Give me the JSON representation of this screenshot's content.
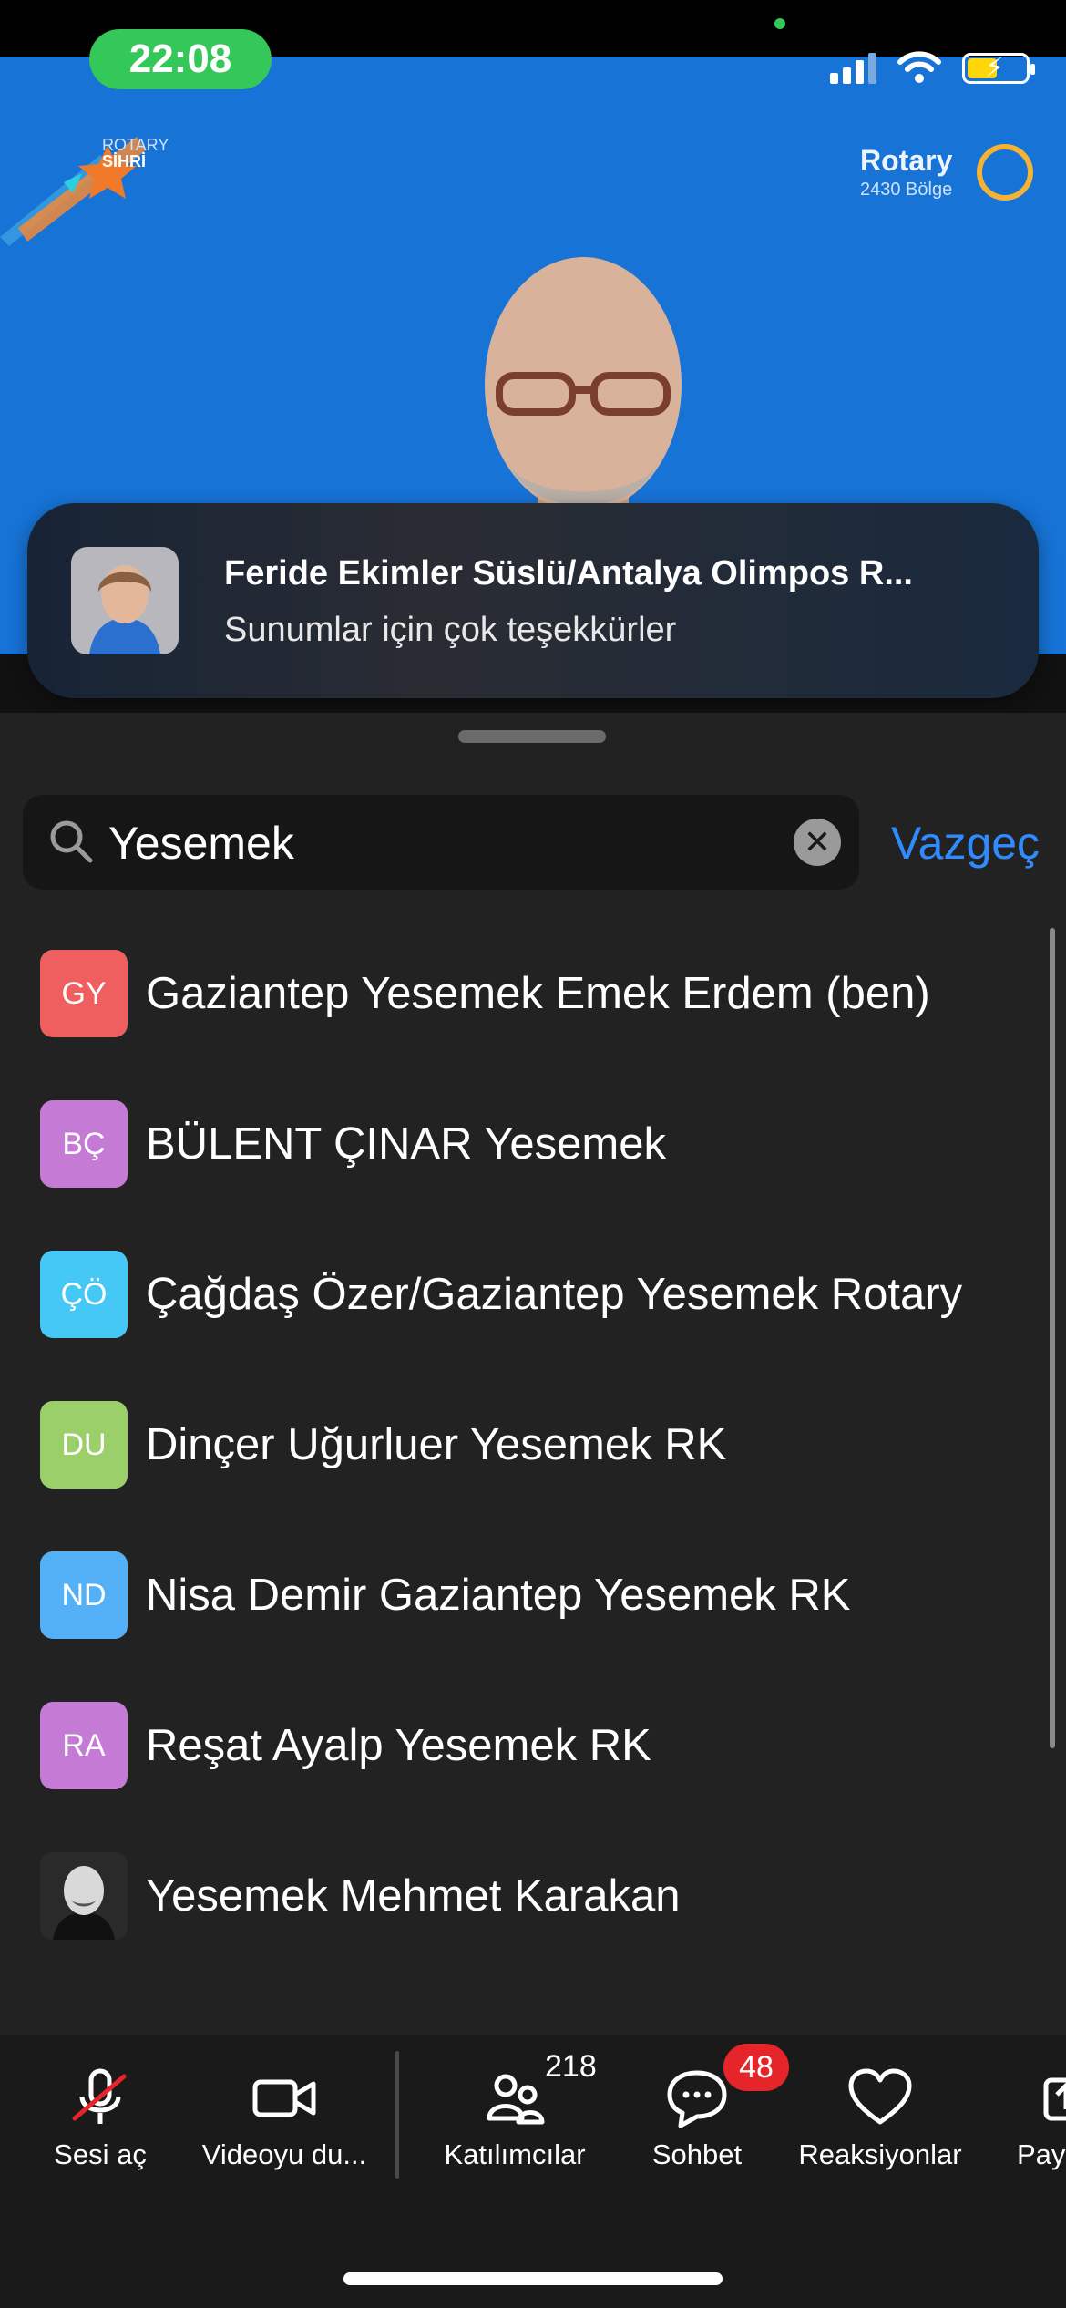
{
  "status_bar": {
    "time": "22:08"
  },
  "video": {
    "logo_left_text": [
      "ROTARY",
      "SİHRİ"
    ],
    "logo_right_word": "Rotary",
    "logo_right_sub": "2430 Bölge"
  },
  "toast": {
    "sender": "Feride Ekimler Süslü/Antalya Olimpos R...",
    "message": "Sunumlar için çok teşekkürler"
  },
  "search": {
    "query": "Yesemek",
    "cancel_label": "Vazgeç"
  },
  "participants": [
    {
      "initials": "GY",
      "name": "Gaziantep Yesemek Emek Erdem (ben)",
      "color": "#f05f5f"
    },
    {
      "initials": "BÇ",
      "name": "BÜLENT ÇINAR Yesemek",
      "color": "#c57ad6"
    },
    {
      "initials": "ÇÖ",
      "name": "Çağdaş Özer/Gaziantep Yesemek Rotary",
      "color": "#45c8f5"
    },
    {
      "initials": "DU",
      "name": "Dinçer Uğurluer Yesemek RK",
      "color": "#9bcf6a"
    },
    {
      "initials": "ND",
      "name": "Nisa Demir Gaziantep Yesemek RK",
      "color": "#55b1f7"
    },
    {
      "initials": "RA",
      "name": "Reşat Ayalp Yesemek RK",
      "color": "#c57ad6"
    },
    {
      "initials": "",
      "name": "Yesemek Mehmet Karakan",
      "color": "#3a3a3a"
    }
  ],
  "toolbar": {
    "mic_label": "Sesi aç",
    "video_label": "Videoyu du...",
    "participants_label": "Katılımcılar",
    "participants_count": "218",
    "chat_label": "Sohbet",
    "chat_badge": "48",
    "reactions_label": "Reaksiyonlar",
    "share_label": "Pay"
  },
  "colors": {
    "accent": "#2f8bff",
    "badge": "#e5252a",
    "video_bg": "#1773d6"
  }
}
